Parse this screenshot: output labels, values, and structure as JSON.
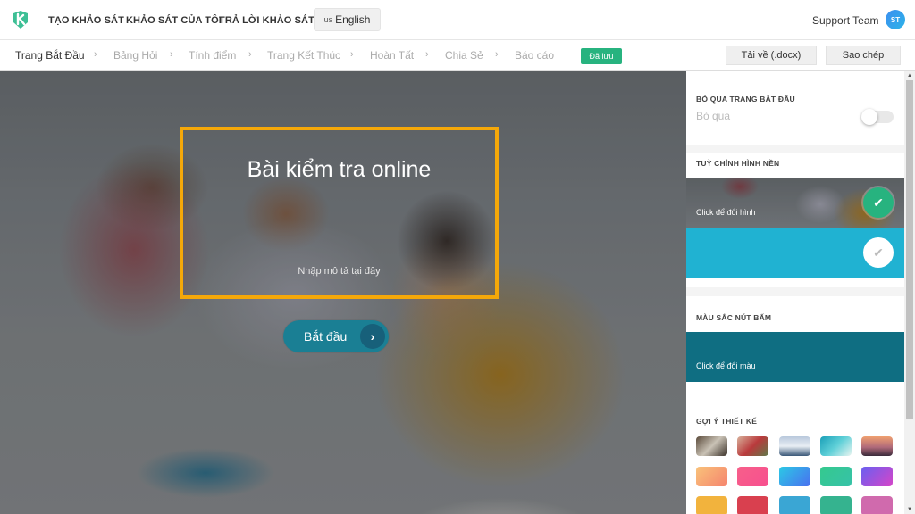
{
  "topbar": {
    "nav": [
      {
        "label": "TẠO KHẢO SÁT"
      },
      {
        "label": "KHẢO SÁT CỦA TÔI"
      },
      {
        "label": "TRẢ LỜI KHẢO SÁT"
      }
    ],
    "language": {
      "flag": "us",
      "label": "English"
    },
    "user": {
      "name": "Support Team",
      "initials": "ST"
    },
    "brand_color": "#3dbf95"
  },
  "steps": {
    "items": [
      {
        "label": "Trang Bắt Đầu",
        "active": true
      },
      {
        "label": "Bảng Hỏi",
        "active": false
      },
      {
        "label": "Tính điểm",
        "active": false
      },
      {
        "label": "Trang Kết Thúc",
        "active": false
      },
      {
        "label": "Hoàn Tất",
        "active": false
      },
      {
        "label": "Chia Sẻ",
        "active": false
      },
      {
        "label": "Báo cáo",
        "active": false
      }
    ],
    "separator": "›",
    "saved_badge": "Đã lưu",
    "download_button": "Tải về (.docx)",
    "copy_button": "Sao chép"
  },
  "stage": {
    "title": "Bài kiểm tra online",
    "description_placeholder": "Nhập mô tả tại đây",
    "start_button": "Bắt đầu",
    "start_arrow": "›",
    "highlight_color": "#f5a809",
    "button_color": "#1a7f94"
  },
  "panel": {
    "skip_section": {
      "title": "BỎ QUA TRANG BẮT ĐẦU",
      "label": "Bỏ qua",
      "enabled": false
    },
    "background_section": {
      "title": "TUỲ CHỈNH HÌNH NỀN",
      "image_option_label": "Click để đổi hình",
      "image_selected": true,
      "color_option": "#20b2d2",
      "color_selected": false,
      "check_glyph": "✔"
    },
    "button_color_section": {
      "title": "MÀU SẮC NÚT BẤM",
      "label": "Click để đổi màu",
      "color": "#0f6e82"
    },
    "design_suggestions": {
      "title": "GỢI Ý THIẾT KẾ",
      "image_swatches": [
        "wedding-hall",
        "flowers",
        "sea-cliffs",
        "tropical-beach",
        "sunset-lake"
      ],
      "gradient_swatches": [
        {
          "from": "#f9c27a",
          "to": "#f5846e"
        },
        {
          "from": "#f75f8a",
          "to": "#f7508f"
        },
        {
          "from": "#2bc9e5",
          "to": "#4a6ff0"
        },
        {
          "from": "#35c98e",
          "to": "#36c2a8"
        },
        {
          "from": "#6a5ff0",
          "to": "#d645c8"
        }
      ],
      "solid_swatches": [
        "#f2b33d",
        "#d9404f",
        "#3aa6d4",
        "#35b38f",
        "#d06aad"
      ]
    }
  },
  "scrollbar": {
    "up": "▲",
    "down": "▼"
  }
}
